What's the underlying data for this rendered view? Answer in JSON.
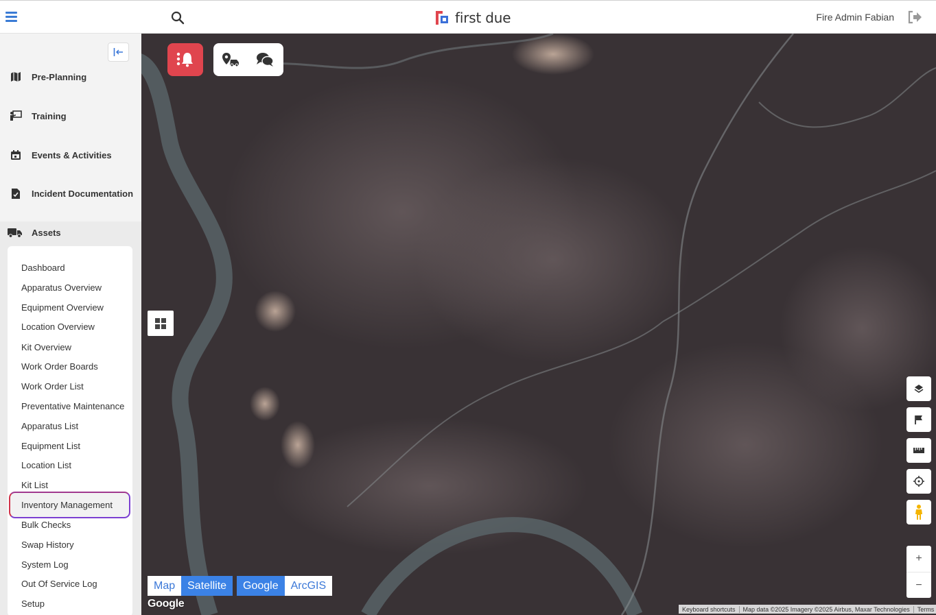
{
  "header": {
    "app_name": "first due",
    "user_name": "Fire Admin Fabian"
  },
  "sidebar": {
    "items": [
      {
        "label": "Pre-Planning",
        "icon": "map-icon"
      },
      {
        "label": "Training",
        "icon": "training-icon"
      },
      {
        "label": "Events & Activities",
        "icon": "calendar-icon"
      },
      {
        "label": "Incident Documentation",
        "icon": "document-check-icon"
      },
      {
        "label": "Assets",
        "icon": "truck-icon"
      }
    ],
    "assets_submenu": [
      "Dashboard",
      "Apparatus Overview",
      "Equipment Overview",
      "Location Overview",
      "Kit Overview",
      "Work Order Boards",
      "Work Order List",
      "Preventative Maintenance",
      "Apparatus List",
      "Equipment List",
      "Location List",
      "Kit List",
      "Inventory Management",
      "Bulk Checks",
      "Swap History",
      "System Log",
      "Out Of Service Log",
      "Setup"
    ],
    "highlighted_item": "Inventory Management"
  },
  "map": {
    "type_buttons": [
      "Map",
      "Satellite"
    ],
    "active_type": "Satellite",
    "source_buttons": [
      "Google",
      "ArcGIS"
    ],
    "active_source": "Google",
    "zoom_in": "+",
    "zoom_out": "−",
    "google_logo": "Google",
    "attribution": {
      "shortcuts": "Keyboard shortcuts",
      "data": "Map data ©2025 Imagery ©2025 Airbus, Maxar Technologies",
      "terms": "Terms"
    }
  },
  "colors": {
    "accent": "#3b82e6",
    "alert": "#e0454e",
    "highlight_border": "#7b3fd1"
  }
}
